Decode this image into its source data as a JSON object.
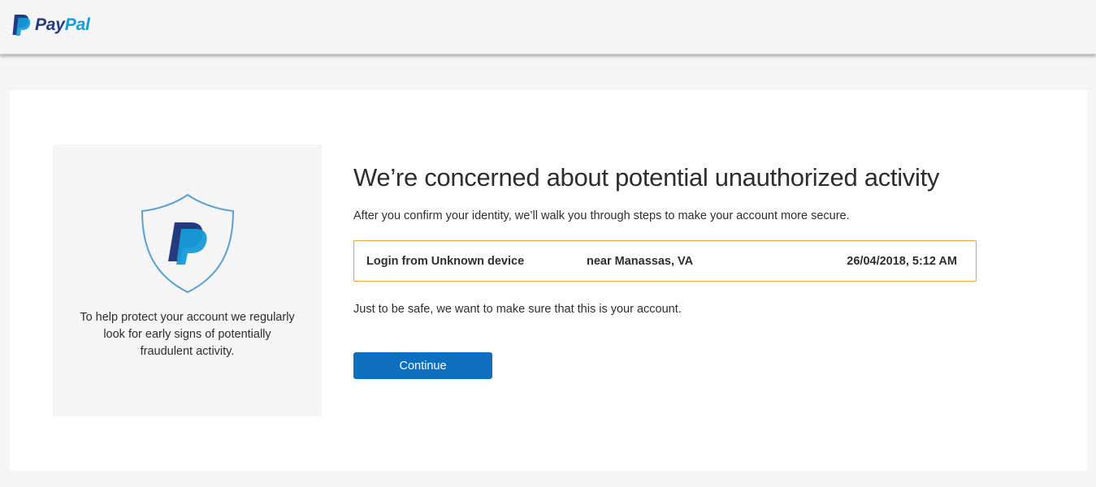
{
  "header": {
    "logo_pay": "Pay",
    "logo_pal": "Pal"
  },
  "side_panel": {
    "text": "To help protect your account we regularly look for early signs of potentially fraudulent activity."
  },
  "main": {
    "heading": "We’re concerned about potential unauthorized activity",
    "subtitle": "After you confirm your identity, we’ll walk you through steps to make your account more secure.",
    "activity": {
      "device": "Login from Unknown device",
      "location": "near Manassas, VA",
      "datetime": "26/04/2018, 5:12 AM"
    },
    "note": "Just to be safe, we want to make sure that this is your account.",
    "continue_label": "Continue"
  },
  "colors": {
    "brand_dark_blue": "#253b80",
    "brand_light_blue": "#179bd7",
    "button_blue": "#0e6fbf",
    "alert_border": "#e7a33e",
    "shield_outline": "#5ba0d0"
  },
  "icons": {
    "logo": "paypal-logo-icon",
    "shield": "paypal-shield-icon"
  }
}
